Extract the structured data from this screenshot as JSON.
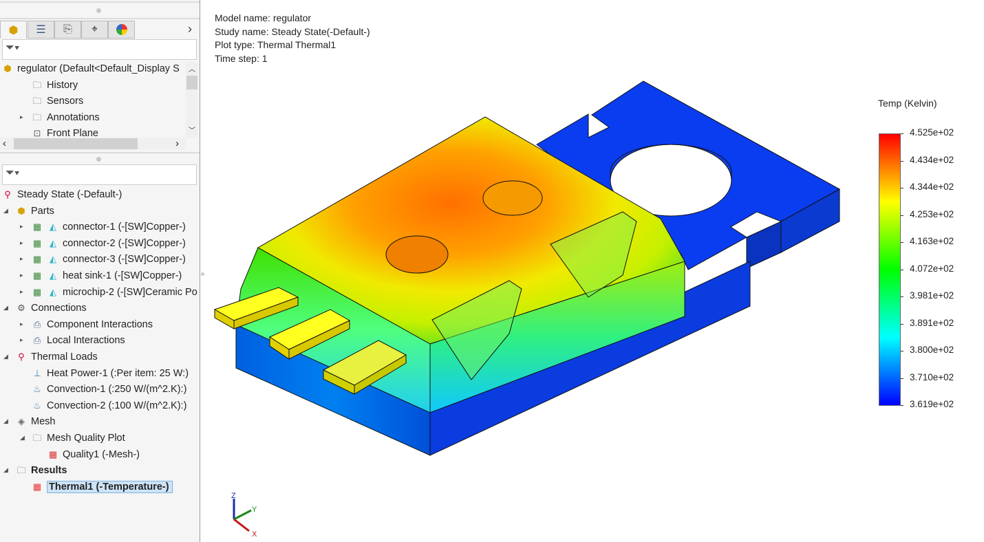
{
  "panel": {
    "tabs": [
      {
        "icon": "feature-manager-icon"
      },
      {
        "icon": "property-manager-icon"
      },
      {
        "icon": "configuration-manager-icon"
      },
      {
        "icon": "dimxpert-icon"
      },
      {
        "icon": "display-manager-icon"
      }
    ],
    "tabs_more": "›",
    "filter_icon": "filter-icon",
    "top_tree": [
      {
        "label": "regulator  (Default<Default_Display S",
        "icon": "assembly-icon",
        "level": 0
      },
      {
        "label": "History",
        "icon": "history-folder-icon",
        "level": 1
      },
      {
        "label": "Sensors",
        "icon": "sensors-folder-icon",
        "level": 1
      },
      {
        "label": "Annotations",
        "icon": "annotations-folder-icon",
        "level": 1,
        "expandable": true
      },
      {
        "label": "Front Plane",
        "icon": "plane-icon",
        "level": 1
      }
    ],
    "study_tree": [
      {
        "label": "Steady State (-Default-)",
        "icon": "thermal-study-icon",
        "level": 0
      },
      {
        "label": "Parts",
        "icon": "parts-icon",
        "level": 0,
        "expanded": true
      },
      {
        "label": "connector-1 (-[SW]Copper-)",
        "icon": "solid-body-icon",
        "level": 1,
        "expandable": true
      },
      {
        "label": "connector-2 (-[SW]Copper-)",
        "icon": "solid-body-icon",
        "level": 1,
        "expandable": true
      },
      {
        "label": "connector-3 (-[SW]Copper-)",
        "icon": "solid-body-icon",
        "level": 1,
        "expandable": true
      },
      {
        "label": "heat sink-1 (-[SW]Copper-)",
        "icon": "solid-body-icon",
        "level": 1,
        "expandable": true
      },
      {
        "label": "microchip-2 (-[SW]Ceramic Po",
        "icon": "solid-body-icon",
        "level": 1,
        "expandable": true
      },
      {
        "label": "Connections",
        "icon": "connections-icon",
        "level": 0,
        "expanded": true
      },
      {
        "label": "Component Interactions",
        "icon": "component-interactions-icon",
        "level": 1,
        "expandable": true
      },
      {
        "label": "Local Interactions",
        "icon": "local-interactions-icon",
        "level": 1,
        "expandable": true
      },
      {
        "label": "Thermal Loads",
        "icon": "thermal-loads-icon",
        "level": 0,
        "expanded": true
      },
      {
        "label": "Heat Power-1 (:Per item: 25 W:)",
        "icon": "heat-power-icon",
        "level": 1
      },
      {
        "label": "Convection-1 (:250 W/(m^2.K):)",
        "icon": "convection-icon",
        "level": 1
      },
      {
        "label": "Convection-2 (:100 W/(m^2.K):)",
        "icon": "convection-icon",
        "level": 1
      },
      {
        "label": "Mesh",
        "icon": "mesh-icon",
        "level": 0,
        "expanded": true
      },
      {
        "label": "Mesh Quality Plot",
        "icon": "plot-folder-icon",
        "level": 1,
        "expanded": true
      },
      {
        "label": "Quality1 (-Mesh-)",
        "icon": "quality-plot-icon",
        "level": 2
      },
      {
        "label": "Results",
        "icon": "results-folder-icon",
        "level": 0,
        "expanded": true,
        "bold": true
      },
      {
        "label": "Thermal1 (-Temperature-)",
        "icon": "thermal-plot-icon",
        "level": 1,
        "selected": true
      }
    ]
  },
  "viewport": {
    "info": [
      "Model name: regulator",
      "Study name: Steady State(-Default-)",
      "Plot type: Thermal Thermal1",
      "Time step: 1"
    ],
    "legend": {
      "title": "Temp (Kelvin)",
      "max": 452.5,
      "min": 361.9,
      "labels": [
        "4.525e+02",
        "4.434e+02",
        "4.344e+02",
        "4.253e+02",
        "4.163e+02",
        "4.072e+02",
        "3.981e+02",
        "3.891e+02",
        "3.800e+02",
        "3.710e+02",
        "3.619e+02"
      ],
      "colors": [
        "#ff0000",
        "#ff8000",
        "#ffff00",
        "#80ff00",
        "#00ff00",
        "#00ff80",
        "#00ffff",
        "#0080ff",
        "#0000ff"
      ]
    },
    "triad": {
      "x": "X",
      "y": "Y",
      "z": "Z"
    }
  }
}
